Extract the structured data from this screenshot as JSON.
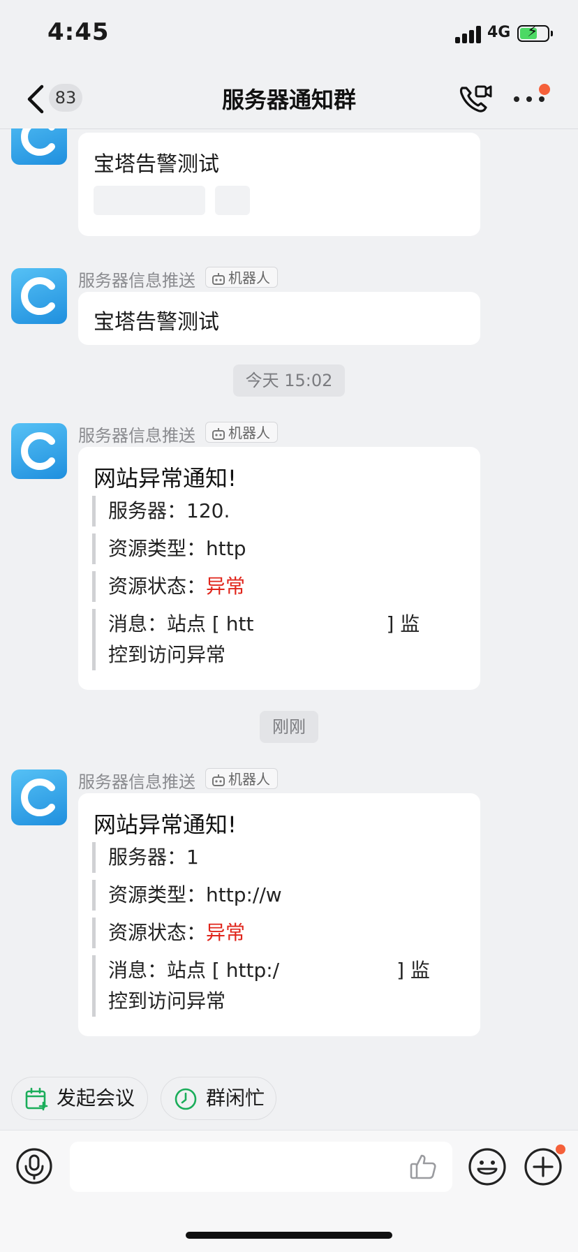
{
  "status_bar": {
    "time": "4:45",
    "network": "4G"
  },
  "nav": {
    "back_badge": "83",
    "title": "服务器通知群"
  },
  "messages": [
    {
      "body": "宝塔告警测试"
    },
    {
      "sender": "服务器信息推送",
      "tag": "机器人",
      "body": "宝塔告警测试"
    },
    {
      "time_divider": "今天 15:02"
    },
    {
      "sender": "服务器信息推送",
      "tag": "机器人",
      "title": "网站异常通知!",
      "server_label": "服务器：",
      "server_value": "120.",
      "type_label": "资源类型：",
      "type_value": "http",
      "state_label": "资源状态：",
      "state_value": "异常",
      "msg_label": "消息：",
      "msg_value": "站点 [  htt",
      "msg_bracket": "] 监",
      "msg_line2": "控到访问异常"
    },
    {
      "time_divider": "刚刚"
    },
    {
      "sender": "服务器信息推送",
      "tag": "机器人",
      "title": "网站异常通知!",
      "server_label": "服务器：",
      "server_value": "1",
      "type_label": "资源类型：",
      "type_value": "http://w",
      "state_label": "资源状态：",
      "state_value": "异常",
      "msg_label": "消息：",
      "msg_value": "站点 [  http:/",
      "msg_bracket": "] 监",
      "msg_line2": "控到访问异常"
    }
  ],
  "quick_actions": [
    {
      "label": "发起会议"
    },
    {
      "label": "群闲忙"
    }
  ],
  "colors": {
    "alert_red": "#e0251b",
    "accent_green": "#1aad5a",
    "notify_orange": "#f5603a"
  }
}
